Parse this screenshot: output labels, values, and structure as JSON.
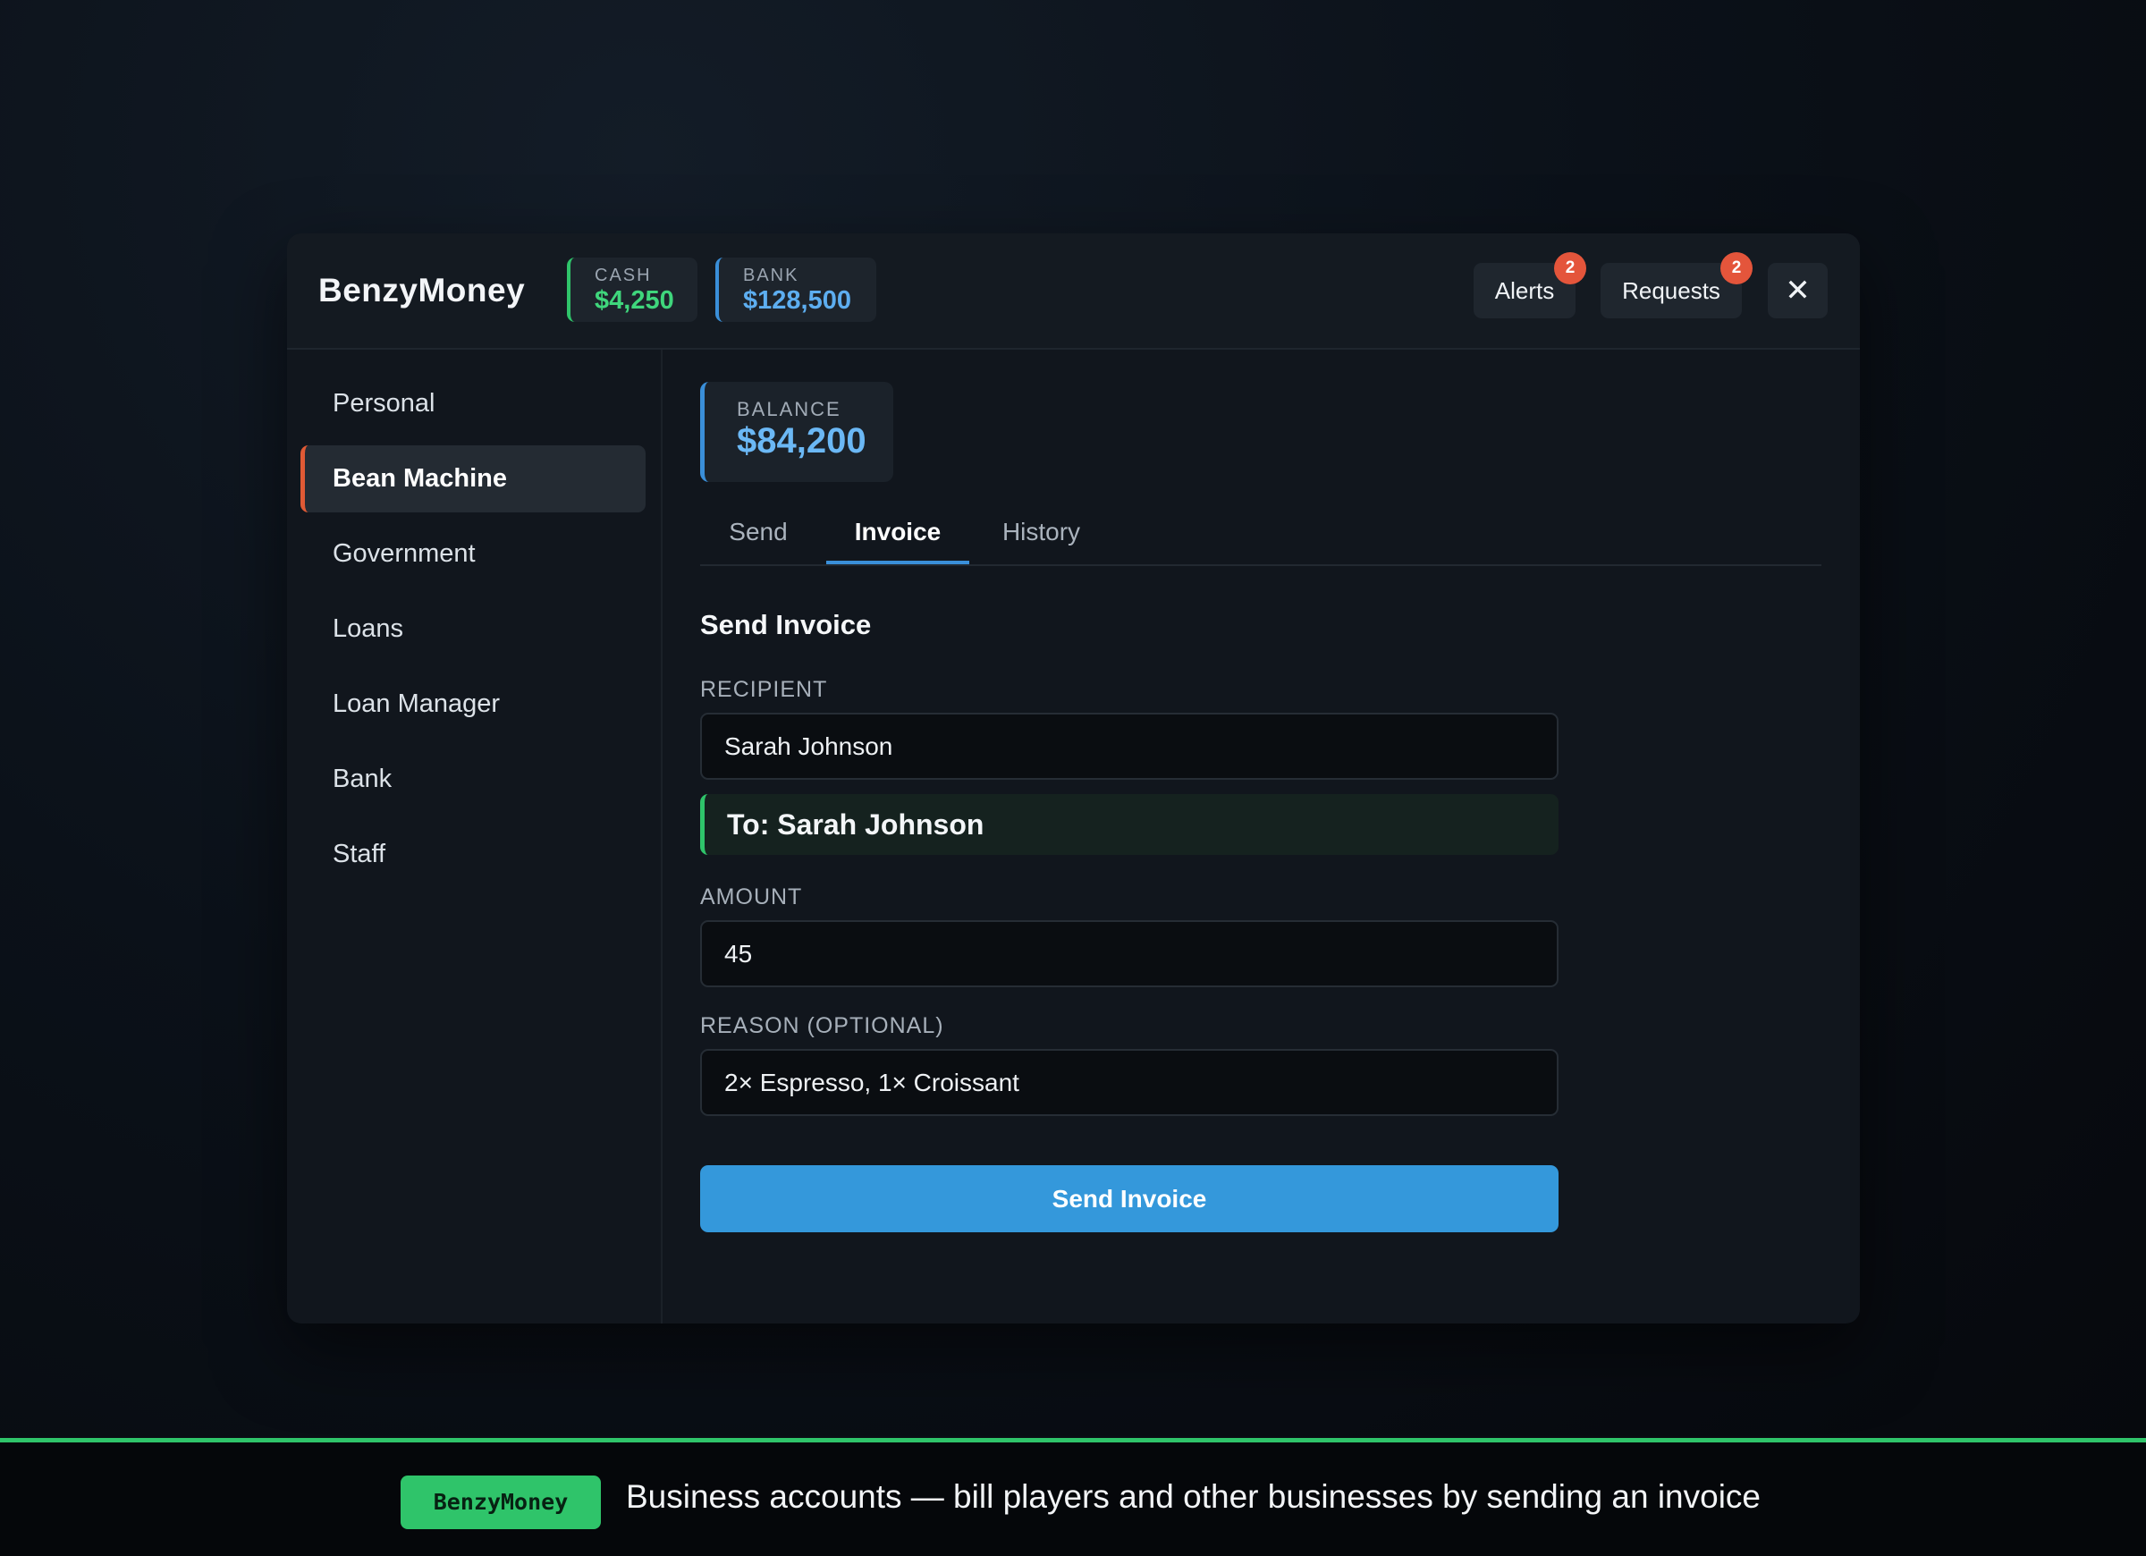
{
  "app": {
    "title": "BenzyMoney",
    "wallets": {
      "cash": {
        "label": "CASH",
        "value": "$4,250"
      },
      "bank": {
        "label": "BANK",
        "value": "$128,500"
      }
    },
    "header_buttons": {
      "alerts": {
        "label": "Alerts",
        "badge": "2"
      },
      "requests": {
        "label": "Requests",
        "badge": "2"
      },
      "close": {
        "label": "✕"
      }
    }
  },
  "sidebar": {
    "items": [
      {
        "label": "Personal",
        "active": false
      },
      {
        "label": "Bean Machine",
        "active": true
      },
      {
        "label": "Government",
        "active": false
      },
      {
        "label": "Loans",
        "active": false
      },
      {
        "label": "Loan Manager",
        "active": false
      },
      {
        "label": "Bank",
        "active": false
      },
      {
        "label": "Staff",
        "active": false
      }
    ]
  },
  "main": {
    "balance": {
      "label": "BALANCE",
      "value": "$84,200"
    },
    "tabs": [
      {
        "label": "Send",
        "active": false
      },
      {
        "label": "Invoice",
        "active": true
      },
      {
        "label": "History",
        "active": false
      }
    ],
    "form": {
      "title": "Send Invoice",
      "recipient": {
        "label": "RECIPIENT",
        "value": "Sarah Johnson",
        "confirmation": "To: Sarah Johnson"
      },
      "amount": {
        "label": "AMOUNT",
        "value": "45"
      },
      "reason": {
        "label": "REASON (OPTIONAL)",
        "value": "2× Espresso, 1× Croissant"
      },
      "submit_label": "Send Invoice"
    }
  },
  "footer": {
    "badge": "BenzyMoney",
    "caption": "Business accounts — bill players and other businesses by sending an invoice"
  },
  "colors": {
    "accent": "#3498db",
    "cash": "#3fd67c",
    "bank": "#5daef0",
    "active_nav": "#e05a35",
    "badge": "#e4553b",
    "footer_accent": "#2fc46a"
  }
}
